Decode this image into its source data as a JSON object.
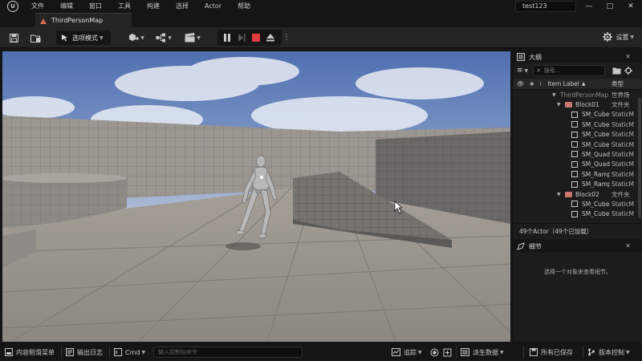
{
  "menu": {
    "items": [
      "文件",
      "编辑",
      "窗口",
      "工具",
      "构建",
      "选择",
      "Actor",
      "帮助"
    ],
    "project_name": "test123",
    "window_controls": [
      "minimize-icon",
      "maximize-icon",
      "close-icon"
    ]
  },
  "tabs": [
    {
      "label": "ThirdPersonMap",
      "icon": "level-icon"
    }
  ],
  "toolbar": {
    "mode_label": "选项模式",
    "settings_label": "设置"
  },
  "outliner": {
    "title": "大纲",
    "search_placeholder": "搜索",
    "columns": {
      "label": "Item Label",
      "sort_indicator": "▲",
      "type": "类型"
    },
    "rows": [
      {
        "label": "ThirdPersonMap",
        "type": "世界场",
        "kind": "world",
        "indent": 0
      },
      {
        "label": "Block01",
        "type": "文件夹",
        "kind": "folder",
        "indent": 1
      },
      {
        "label": "SM_Cube",
        "type": "StaticM",
        "kind": "mesh",
        "indent": 2
      },
      {
        "label": "SM_Cube",
        "type": "StaticM",
        "kind": "mesh",
        "indent": 2
      },
      {
        "label": "SM_Cube",
        "type": "StaticM",
        "kind": "mesh",
        "indent": 2
      },
      {
        "label": "SM_Cube",
        "type": "StaticM",
        "kind": "mesh",
        "indent": 2
      },
      {
        "label": "SM_Quad",
        "type": "StaticM",
        "kind": "mesh",
        "indent": 2
      },
      {
        "label": "SM_Quad",
        "type": "StaticM",
        "kind": "mesh",
        "indent": 2
      },
      {
        "label": "SM_Ramp",
        "type": "StaticM",
        "kind": "mesh",
        "indent": 2
      },
      {
        "label": "SM_Ramp",
        "type": "StaticM",
        "kind": "mesh",
        "indent": 2
      },
      {
        "label": "Block02",
        "type": "文件夹",
        "kind": "folder",
        "indent": 1
      },
      {
        "label": "SM_Cube",
        "type": "StaticM",
        "kind": "mesh",
        "indent": 2
      },
      {
        "label": "SM_Cube",
        "type": "StaticM",
        "kind": "mesh",
        "indent": 2
      }
    ],
    "footer": "49个Actor（49个已加载）"
  },
  "details": {
    "title": "细节",
    "empty_text": "选择一个对象来查看细节。"
  },
  "statusbar": {
    "content_drawer": "内容侧滑菜单",
    "output_log": "输出日志",
    "cmd_label": "Cmd",
    "cmd_placeholder": "输入控制台命令",
    "trace": "追踪",
    "derived_data": "派生数据",
    "save_all": "所有已保存",
    "source_control": "版本控制"
  },
  "colors": {
    "record_red": "#e23b3b",
    "folder": "#c9776b",
    "sky": "#5d78b0"
  }
}
